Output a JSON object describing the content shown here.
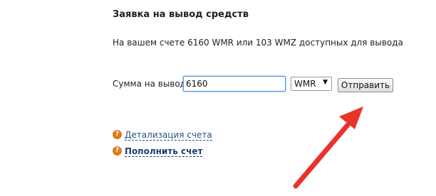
{
  "form": {
    "title": "Заявка на вывод средств",
    "balance_text": "На вашем счете 6160 WMR или 103 WMZ доступных для вывода",
    "amount_label": "Сумма на вывод",
    "amount_value": "6160",
    "currency_selected": "WMR",
    "submit_label": "Отправить"
  },
  "links": {
    "details_label": "Детализация счета",
    "topup_label": "Пополнить счет"
  },
  "colors": {
    "arrow": "#e8332a",
    "help_icon": "#e07b1a",
    "link": "#2a4f86",
    "input_focus_border": "#4a90e2"
  },
  "icons": {
    "help": "question-circle-icon",
    "dropdown": "triangle-down-icon"
  }
}
